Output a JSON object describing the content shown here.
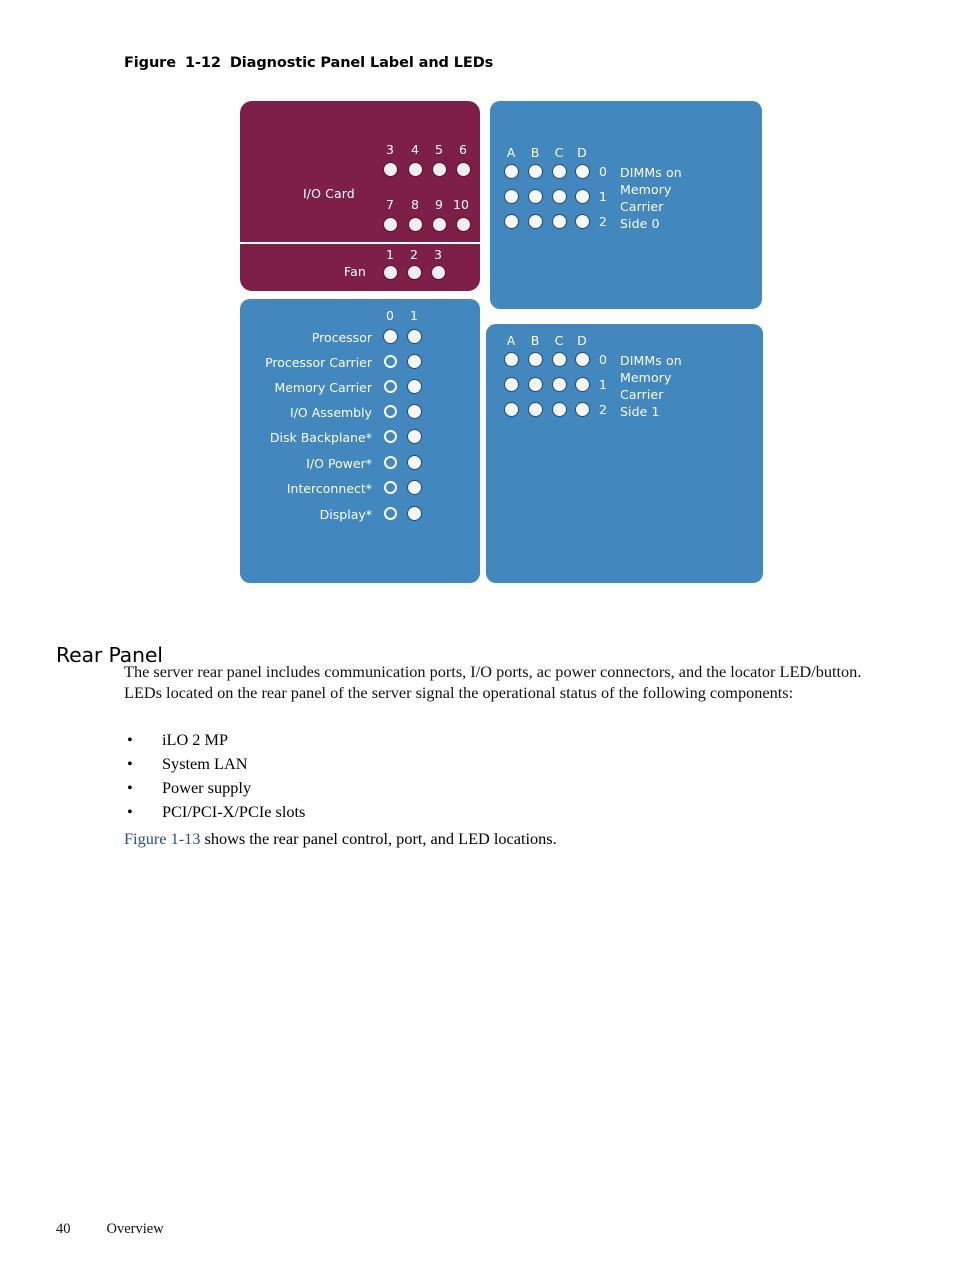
{
  "figure": {
    "caption_label": "Figure",
    "caption_number": "1-12",
    "caption_title": "Diagnostic Panel Label and LEDs",
    "panels": {
      "io_card": {
        "label": "I/O Card",
        "row1_numbers": [
          "3",
          "4",
          "5",
          "6"
        ],
        "row2_numbers": [
          "7",
          "8",
          "9",
          "10"
        ],
        "led_state": "filled"
      },
      "fan": {
        "label": "Fan",
        "numbers": [
          "1",
          "2",
          "3"
        ],
        "led_state": "filled"
      },
      "dimms_side0": {
        "column_headers": [
          "A",
          "B",
          "C",
          "D"
        ],
        "row_numbers": [
          "0",
          "1",
          "2"
        ],
        "caption_lines": [
          "DIMMs on",
          "Memory",
          "Carrier",
          "Side 0"
        ],
        "led_state": "filled"
      },
      "dimms_side1": {
        "column_headers": [
          "A",
          "B",
          "C",
          "D"
        ],
        "row_numbers": [
          "0",
          "1",
          "2"
        ],
        "caption_lines": [
          "DIMMs on",
          "Memory",
          "Carrier",
          "Side 1"
        ],
        "led_state": "filled"
      },
      "components": {
        "column_headers": [
          "0",
          "1"
        ],
        "rows": [
          {
            "label": "Processor",
            "col0": "filled",
            "col1": "filled"
          },
          {
            "label": "Processor Carrier",
            "col0": "ring",
            "col1": "filled"
          },
          {
            "label": "Memory Carrier",
            "col0": "ring",
            "col1": "filled"
          },
          {
            "label": "I/O Assembly",
            "col0": "ring",
            "col1": "filled"
          },
          {
            "label": "Disk Backplane*",
            "col0": "ring",
            "col1": "filled"
          },
          {
            "label": "I/O Power*",
            "col0": "ring",
            "col1": "filled"
          },
          {
            "label": "Interconnect*",
            "col0": "ring",
            "col1": "filled"
          },
          {
            "label": "Display*",
            "col0": "ring",
            "col1": "filled"
          }
        ]
      }
    },
    "colors": {
      "maroon": "#7d1f46",
      "blue": "#4287bd",
      "led_white": "#f5f7f8"
    }
  },
  "section": {
    "heading": "Rear Panel",
    "paragraph": "The server rear panel includes communication ports, I/O ports, ac power connectors, and the locator LED/button. LEDs located on the rear panel of the server signal the operational status of the following components:",
    "bullets": [
      "iLO 2 MP",
      "System LAN",
      "Power supply",
      "PCI/PCI-X/PCIe slots"
    ],
    "bullet_glyph": "•",
    "xref_link": "Figure 1-13",
    "xref_rest": " shows the rear panel control, port, and LED locations.",
    "link_color": "#2b4f81"
  },
  "footer": {
    "page_number": "40",
    "chapter": "Overview"
  }
}
